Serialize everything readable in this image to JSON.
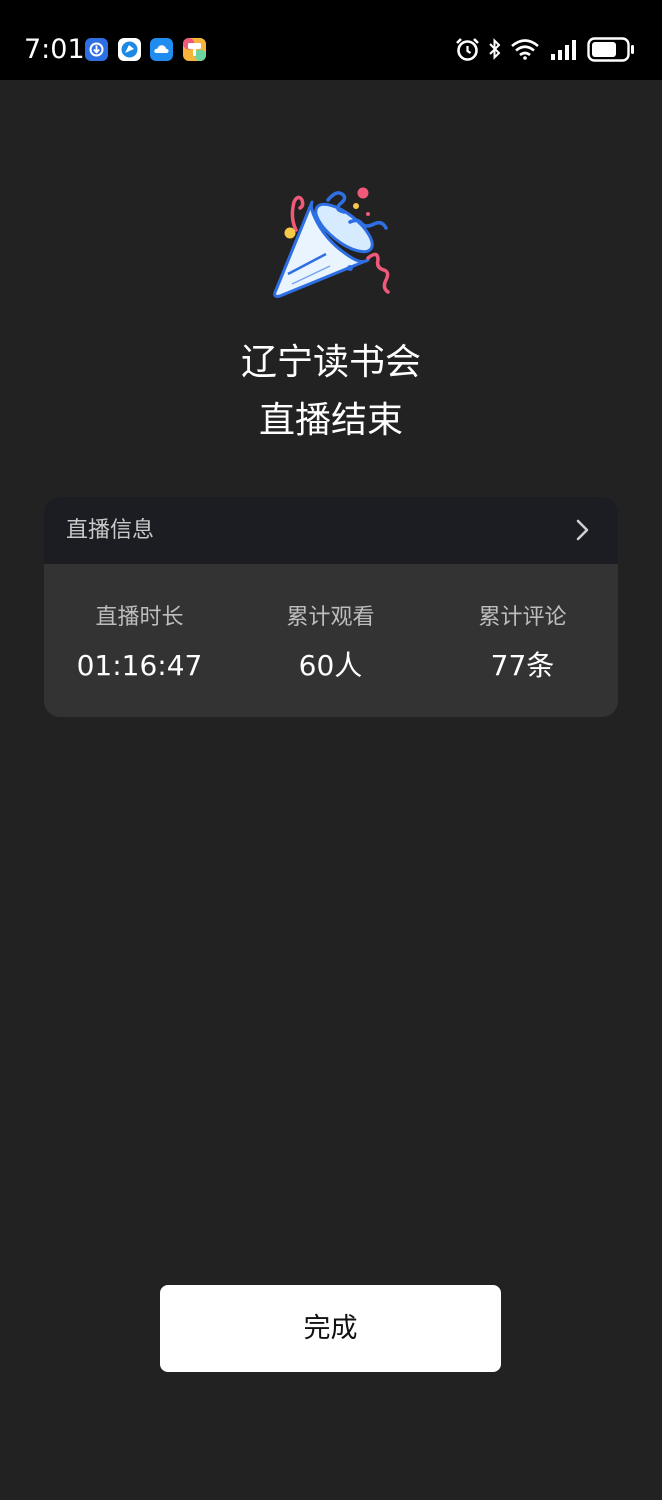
{
  "status_bar": {
    "time": "7:01",
    "notification_icons": [
      "download-app-icon",
      "browser-app-icon",
      "cloud-app-icon",
      "brush-app-icon"
    ],
    "system_icons": [
      "alarm-icon",
      "bluetooth-icon",
      "wifi-icon",
      "signal-icon",
      "battery-icon"
    ]
  },
  "header": {
    "title_line1": "辽宁读书会",
    "title_line2": "直播结束"
  },
  "info_card": {
    "header_label": "直播信息",
    "stats": [
      {
        "label": "直播时长",
        "value": "01:16:47"
      },
      {
        "label": "累计观看",
        "value": "60人"
      },
      {
        "label": "累计评论",
        "value": "77条"
      }
    ]
  },
  "footer": {
    "done_label": "完成"
  },
  "colors": {
    "background": "#222222",
    "card": "#333333",
    "card_header": "#1b1d22",
    "button": "#ffffff"
  }
}
